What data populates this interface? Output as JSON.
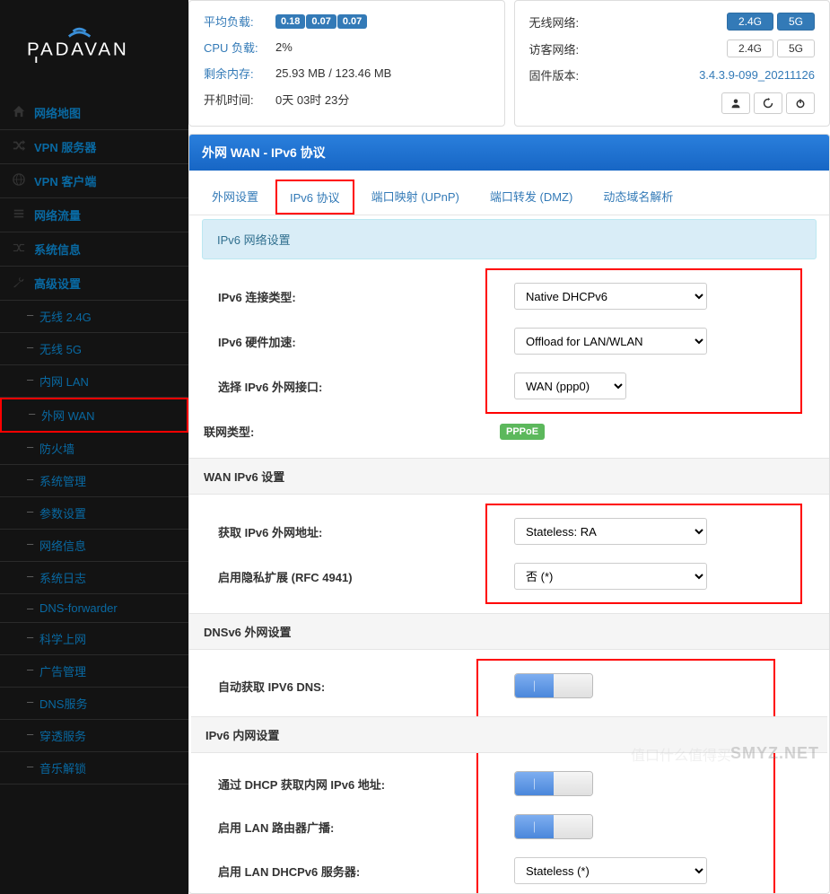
{
  "logo_text": "PADAVAN",
  "nav": [
    {
      "icon": "home",
      "label": "网络地图"
    },
    {
      "icon": "random",
      "label": "VPN 服务器"
    },
    {
      "icon": "globe",
      "label": "VPN 客户端"
    },
    {
      "icon": "bars",
      "label": "网络流量"
    },
    {
      "icon": "shuffle",
      "label": "系统信息"
    },
    {
      "icon": "wrench",
      "label": "高级设置"
    }
  ],
  "subnav": [
    "无线 2.4G",
    "无线 5G",
    "内网 LAN",
    "外网 WAN",
    "防火墙",
    "系统管理",
    "参数设置",
    "网络信息",
    "系统日志",
    "DNS-forwarder",
    "科学上网",
    "广告管理",
    "DNS服务",
    "穿透服务",
    "音乐解锁"
  ],
  "subnav_highlighted_index": 3,
  "status_left": {
    "rows": [
      {
        "label": "平均负载:",
        "badges": [
          "0.18",
          "0.07",
          "0.07"
        ]
      },
      {
        "label": "CPU 负载:",
        "value": "2%"
      },
      {
        "label": "剩余内存:",
        "value": "25.93 MB / 123.46 MB"
      },
      {
        "label": "开机时间:",
        "value": "0天 03时 23分"
      }
    ]
  },
  "status_right": {
    "wireless_label": "无线网络:",
    "guest_label": "访客网络:",
    "firmware_label": "固件版本:",
    "firmware_value": "3.4.3.9-099_20211126",
    "btn_24g": "2.4G",
    "btn_5g": "5G"
  },
  "panel_title": "外网 WAN - IPv6 协议",
  "tabs": [
    "外网设置",
    "IPv6 协议",
    "端口映射 (UPnP)",
    "端口转发 (DMZ)",
    "动态域名解析"
  ],
  "tab_highlighted_index": 1,
  "sections": {
    "s1_title": "IPv6 网络设置",
    "s1_rows": [
      {
        "label": "IPv6 连接类型:",
        "value": "Native DHCPv6",
        "type": "select"
      },
      {
        "label": "IPv6 硬件加速:",
        "value": "Offload for LAN/WLAN",
        "type": "select"
      },
      {
        "label": "选择 IPv6 外网接口:",
        "value": "WAN (ppp0)",
        "type": "select-narrow"
      },
      {
        "label": "联网类型:",
        "value": "PPPoE",
        "type": "tag"
      }
    ],
    "s2_header": "WAN IPv6 设置",
    "s2_rows": [
      {
        "label": "获取 IPv6 外网地址:",
        "value": "Stateless: RA",
        "type": "select"
      },
      {
        "label": "启用隐私扩展 (RFC 4941)",
        "value": "否 (*)",
        "type": "select"
      }
    ],
    "s3_header": "DNSv6 外网设置",
    "s3_rows": [
      {
        "label": "自动获取 IPV6 DNS:",
        "type": "toggle-on"
      }
    ],
    "s4_header": "IPv6 内网设置",
    "s4_rows": [
      {
        "label": "通过 DHCP 获取内网 IPv6 地址:",
        "type": "toggle-on"
      },
      {
        "label": "启用 LAN 路由器广播:",
        "type": "toggle-on"
      },
      {
        "label": "启用 LAN DHCPv6 服务器:",
        "value": "Stateless (*)",
        "type": "select"
      }
    ]
  },
  "watermark1": "SMYZ.NET",
  "watermark2": "值口什么值得买"
}
